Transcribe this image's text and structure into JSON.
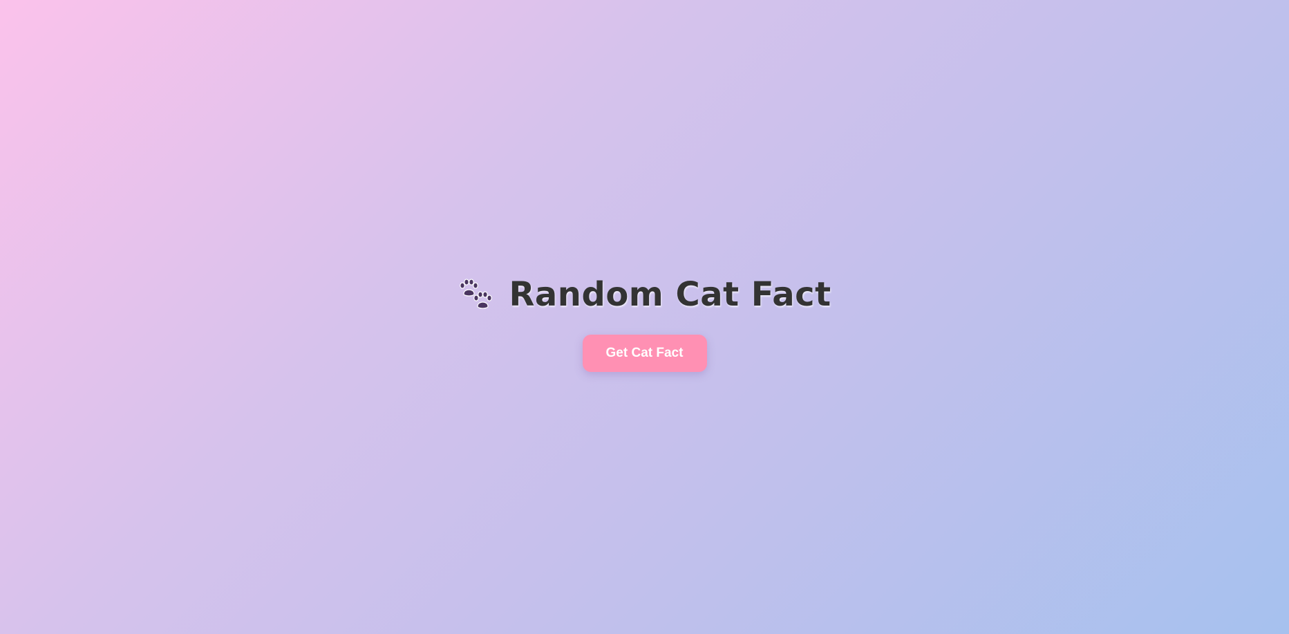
{
  "header": {
    "icon": "paw-prints-icon",
    "title": "Random Cat Fact"
  },
  "actions": {
    "get_fact_label": "Get Cat Fact"
  },
  "colors": {
    "background_start": "#fbc2eb",
    "background_end": "#a6c1ee",
    "title_text": "#333333",
    "button_background": "#ff90b3",
    "button_text": "#ffffff",
    "paw": "#4a3560"
  }
}
